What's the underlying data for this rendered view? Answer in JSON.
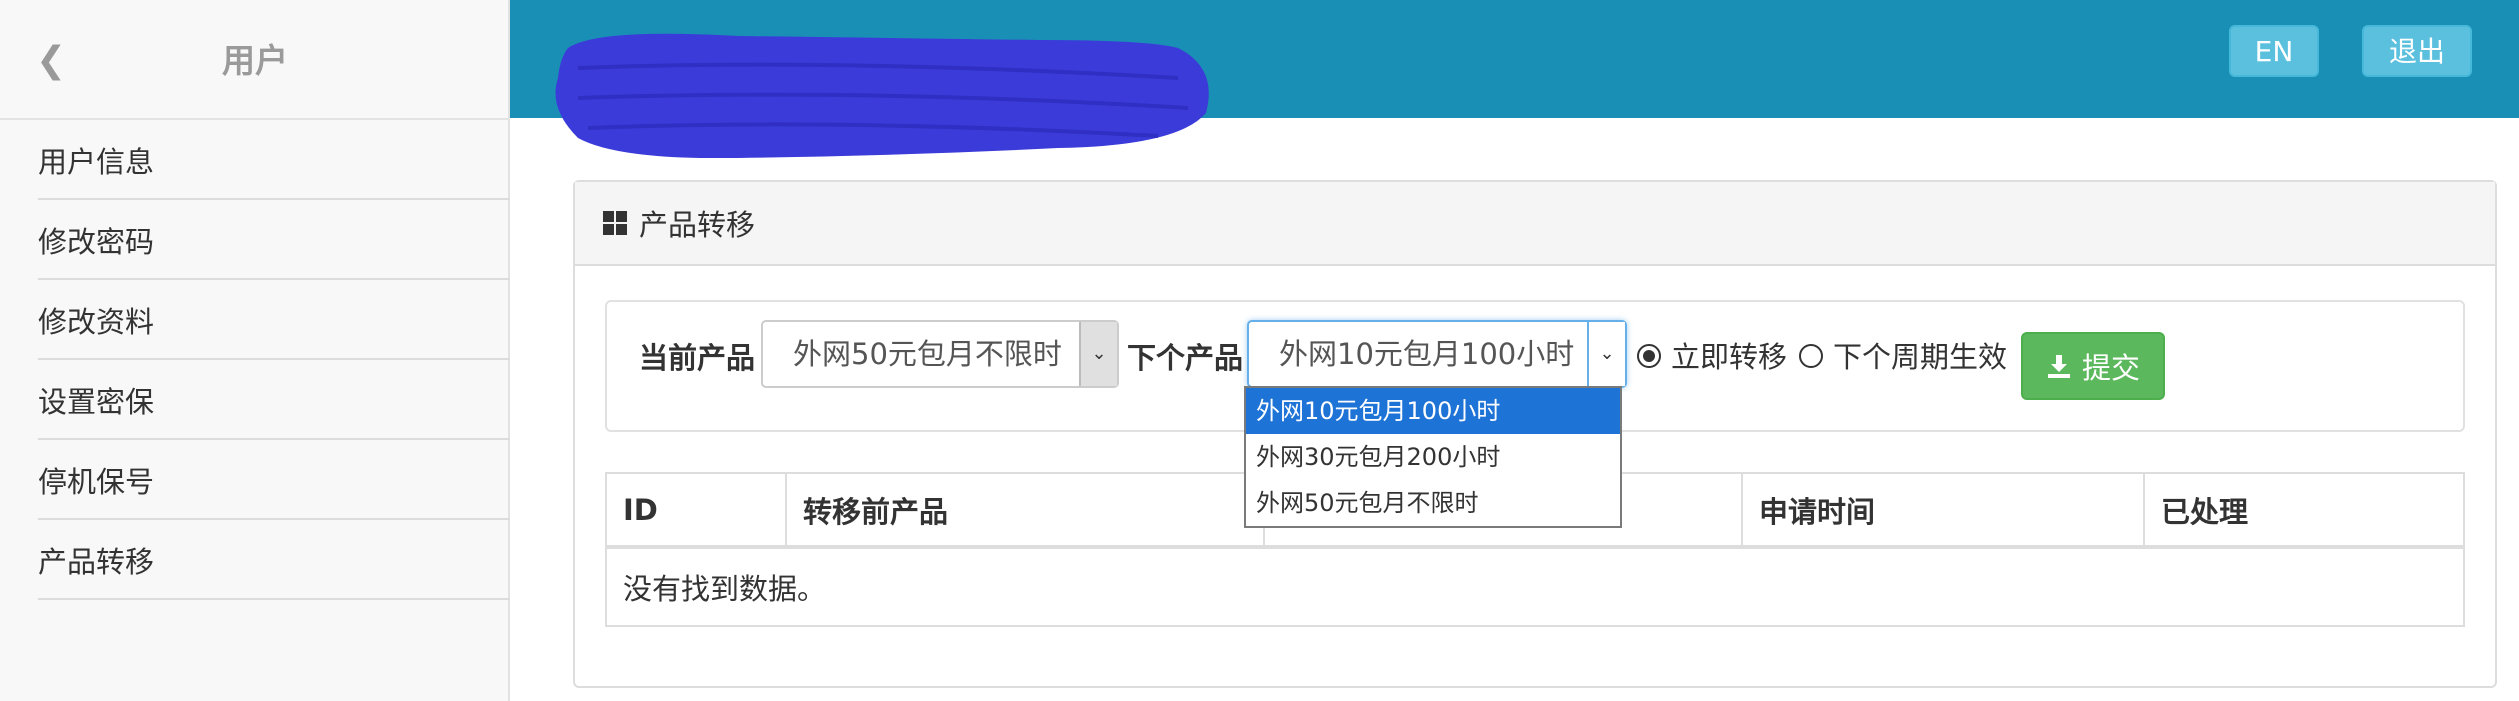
{
  "sidebar": {
    "back_icon": "chevron-left-icon",
    "title": "用户",
    "items": [
      {
        "label": "用户信息"
      },
      {
        "label": "修改密码"
      },
      {
        "label": "修改资料"
      },
      {
        "label": "设置密保"
      },
      {
        "label": "停机保号"
      },
      {
        "label": "产品转移"
      }
    ]
  },
  "header": {
    "bg_color": "#1a8fb5",
    "lang_button": "EN",
    "logout_button": "退出",
    "redaction_color": "#3b3bd9"
  },
  "panel": {
    "icon": "grid-icon",
    "title": "产品转移"
  },
  "form": {
    "current_label": "当前产品",
    "current_value": "外网50元包月不限时",
    "next_label": "下个产品",
    "next_value": "外网10元包月100小时",
    "next_options": [
      "外网10元包月100小时",
      "外网30元包月200小时",
      "外网50元包月不限时"
    ],
    "next_highlighted_index": 0,
    "radio_immediate": "立即转移",
    "radio_next_cycle": "下个周期生效",
    "radio_selected": "立即转移",
    "submit_label": "提交",
    "submit_icon": "download-icon",
    "submit_color": "#5cb85c"
  },
  "table": {
    "columns": [
      "ID",
      "转移前产品",
      "",
      "申请时间",
      "已处理"
    ],
    "empty_message": "没有找到数据。"
  }
}
